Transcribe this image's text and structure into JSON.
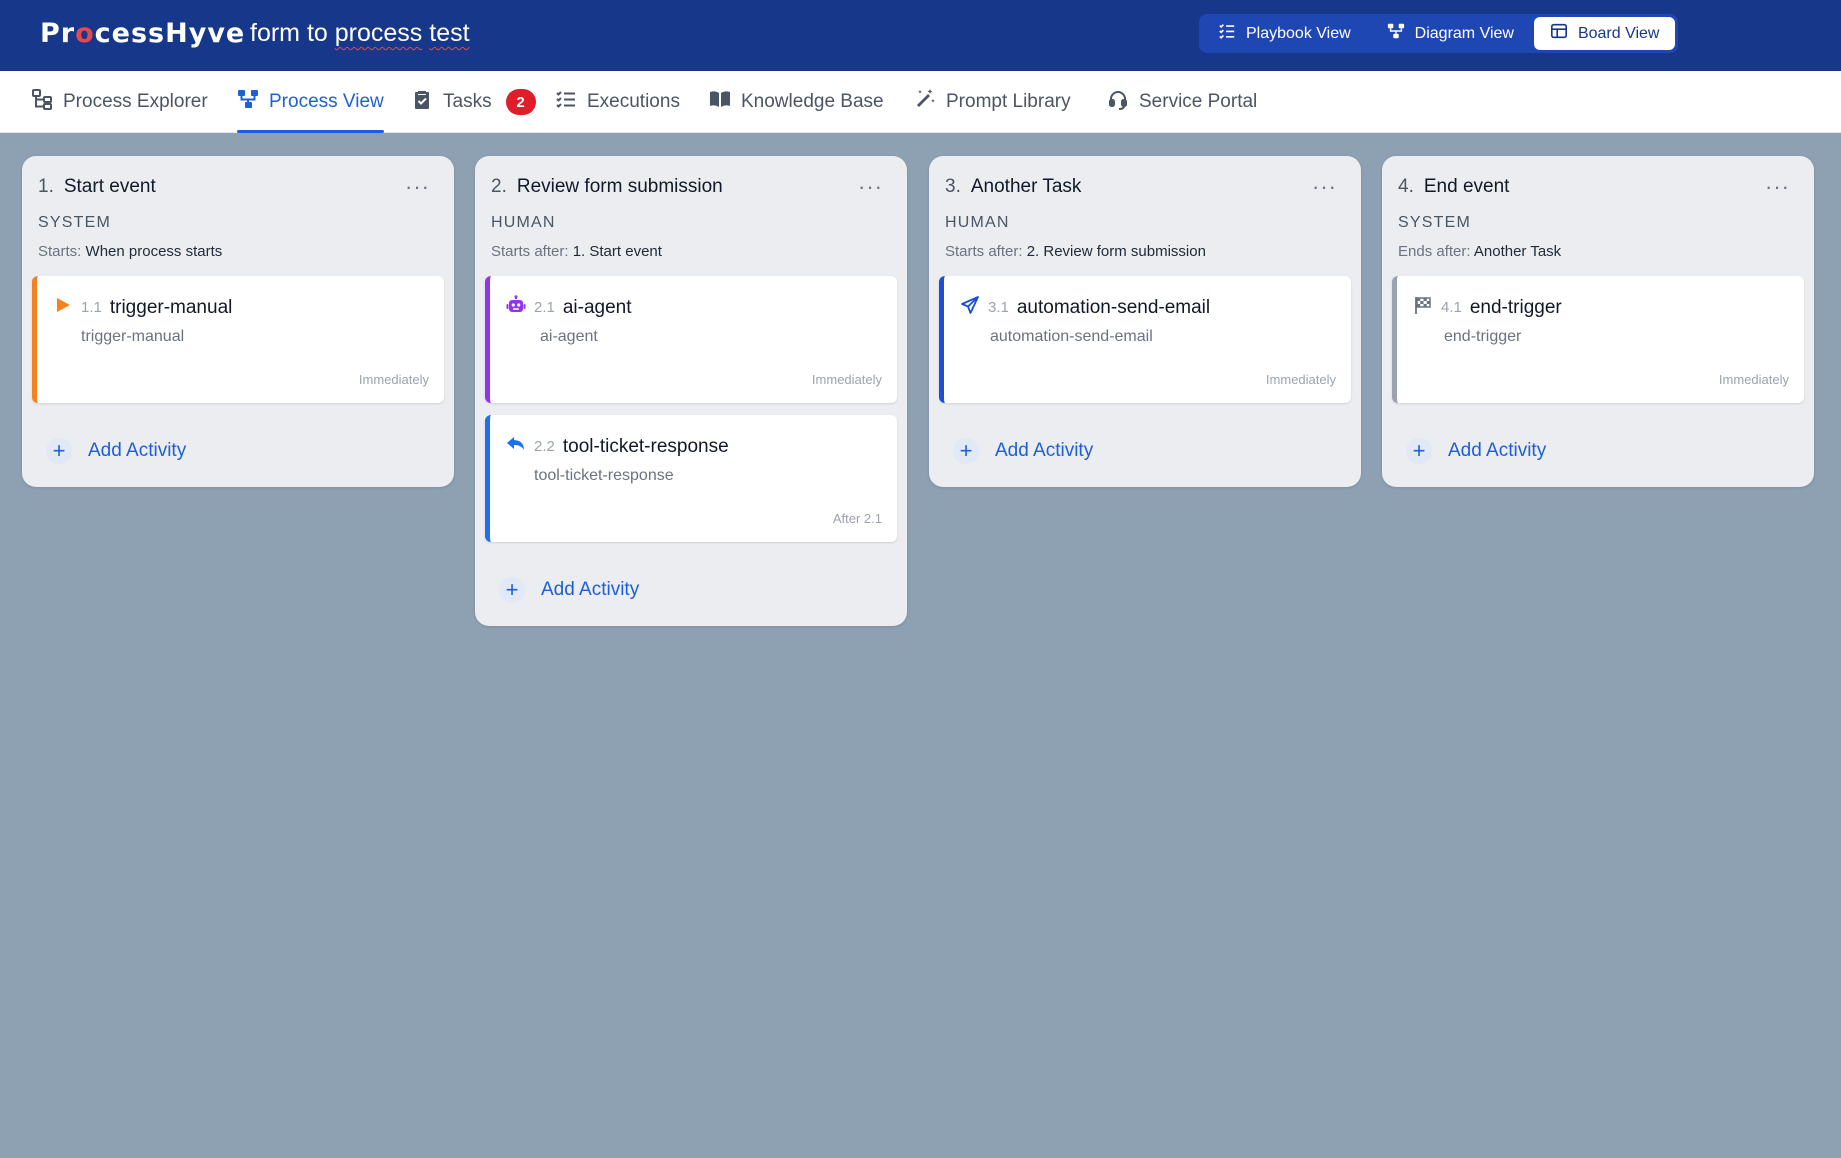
{
  "app": {
    "logo_pre": "Pr",
    "logo_o": "o",
    "logo_post": "cessHyve",
    "process_title_pre": "form to ",
    "process_title_word1": "process",
    "process_title_space": " ",
    "process_title_word2": "test"
  },
  "view_switch": {
    "playbook": "Playbook View",
    "diagram": "Diagram View",
    "board": "Board View",
    "active": "Board View"
  },
  "nav": {
    "items": [
      {
        "label": "Process Explorer",
        "icon": "process-explorer-icon"
      },
      {
        "label": "Process View",
        "icon": "process-view-icon",
        "active": true
      },
      {
        "label": "Tasks",
        "icon": "tasks-icon",
        "badge": "2"
      },
      {
        "label": "Executions",
        "icon": "executions-icon"
      },
      {
        "label": "Knowledge Base",
        "icon": "book-icon"
      },
      {
        "label": "Prompt Library",
        "icon": "magic-wand-icon"
      },
      {
        "label": "Service Portal",
        "icon": "headset-icon"
      }
    ]
  },
  "columns": [
    {
      "num": "1.",
      "title": "Start event",
      "type": "SYSTEM",
      "meta_label": "Starts:",
      "meta_value": "When process starts",
      "menu": "···",
      "cards": [
        {
          "num": "1.1",
          "name": "trigger-manual",
          "sub": "trigger-manual",
          "when": "Immediately",
          "icon": "play-icon",
          "color": "#f58220"
        }
      ],
      "add_label": "Add Activity"
    },
    {
      "num": "2.",
      "title": "Review form submission",
      "type": "HUMAN",
      "meta_label": "Starts after:",
      "meta_value": "1. Start event",
      "menu": "···",
      "cards": [
        {
          "num": "2.1",
          "name": "ai-agent",
          "sub": "ai-agent",
          "when": "Immediately",
          "icon": "robot-icon",
          "color": "#9333ea"
        },
        {
          "num": "2.2",
          "name": "tool-ticket-response",
          "sub": "tool-ticket-response",
          "when": "After 2.1",
          "icon": "reply-icon",
          "color": "#1d6ff2"
        }
      ],
      "add_label": "Add Activity"
    },
    {
      "num": "3.",
      "title": "Another Task",
      "type": "HUMAN",
      "meta_label": "Starts after:",
      "meta_value": "2. Review form submission",
      "menu": "···",
      "cards": [
        {
          "num": "3.1",
          "name": "automation-send-email",
          "sub": "automation-send-email",
          "when": "Immediately",
          "icon": "send-icon",
          "color": "#1d4ed8"
        }
      ],
      "add_label": "Add Activity"
    },
    {
      "num": "4.",
      "title": "End event",
      "type": "SYSTEM",
      "meta_label": "Ends after:",
      "meta_value": "Another Task",
      "menu": "···",
      "cards": [
        {
          "num": "4.1",
          "name": "end-trigger",
          "sub": "end-trigger",
          "when": "Immediately",
          "icon": "flag-checkered-icon",
          "color": "#9ca3af"
        }
      ],
      "add_label": "Add Activity"
    }
  ]
}
